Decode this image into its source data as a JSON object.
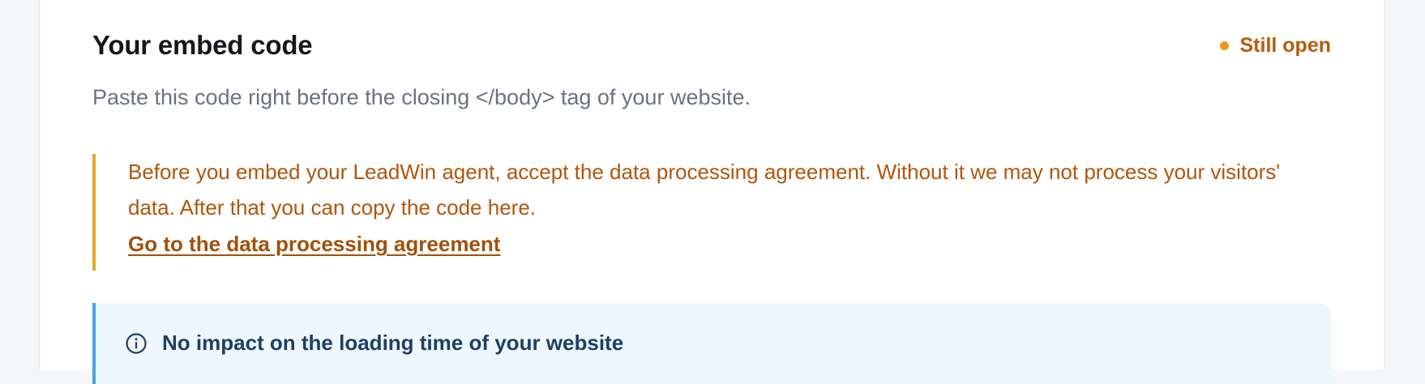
{
  "section": {
    "title": "Your embed code",
    "status_label": "Still open",
    "subtitle": "Paste this code right before the closing </body> tag of your website."
  },
  "notice": {
    "text": "Before you embed your LeadWin agent, accept the data processing agreement. Without it we may not process your visitors' data. After that you can copy the code here.",
    "link_label": "Go to the data processing agreement"
  },
  "info": {
    "icon": "info-circle-icon",
    "title": "No impact on the loading time of your website"
  },
  "colors": {
    "status": "#b45d0b",
    "status_dot": "#e89b1a",
    "notice_border": "#e3a72b",
    "notice_text": "#b0560d",
    "info_border": "#4aa3df",
    "info_bg": "#eef7fd"
  }
}
